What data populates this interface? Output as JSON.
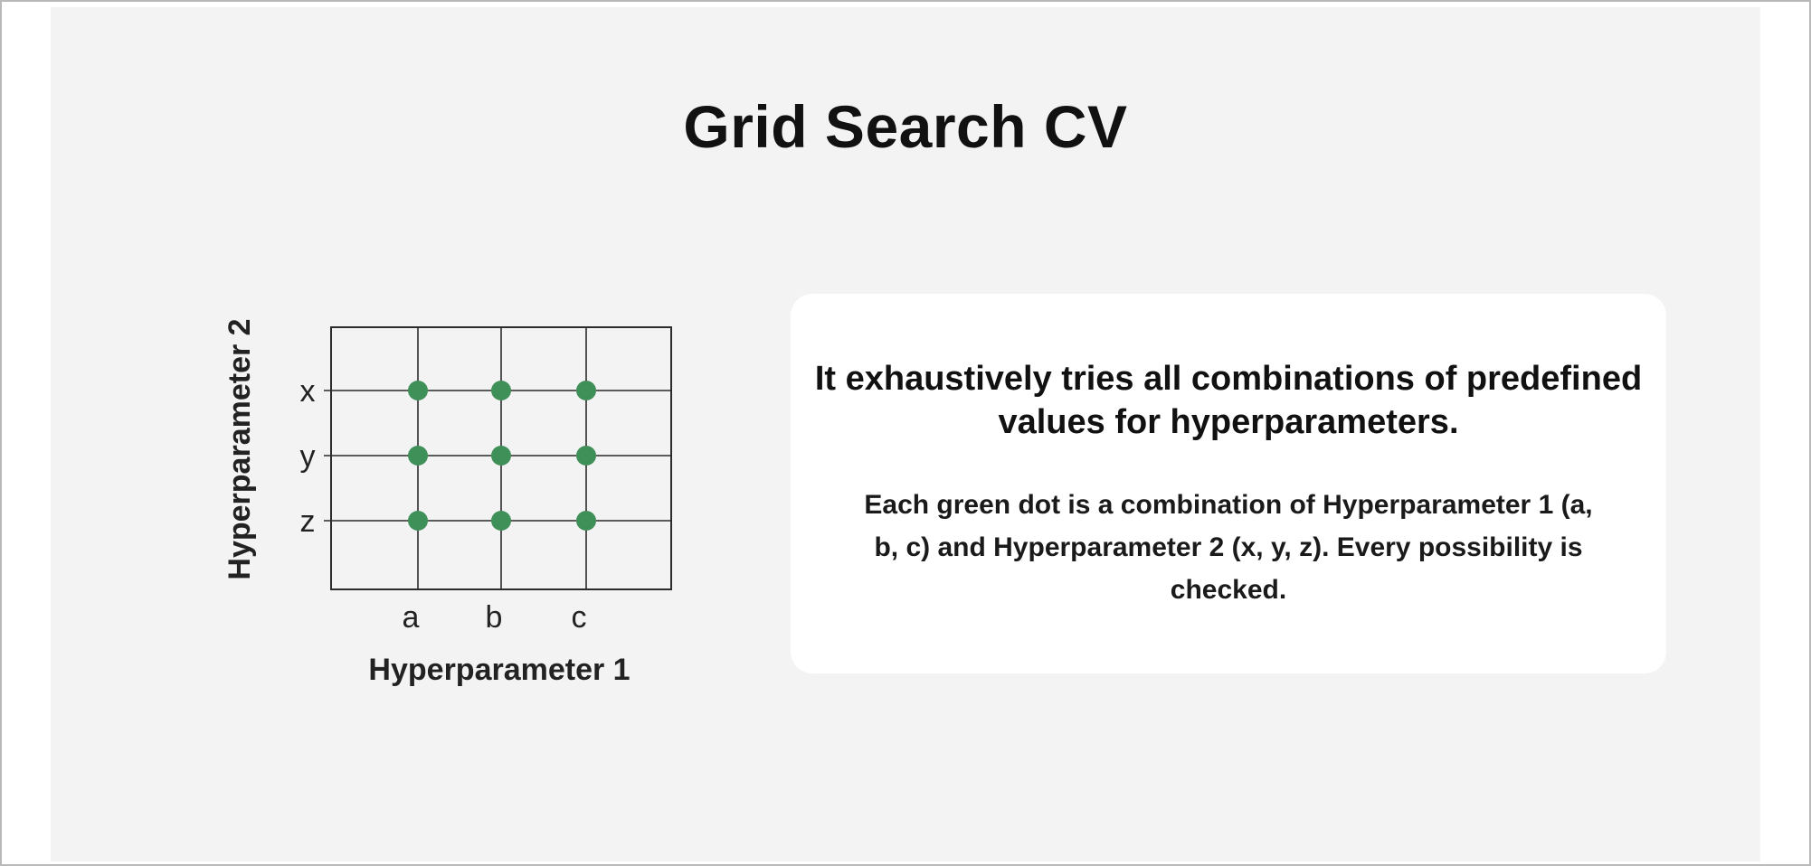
{
  "slide": {
    "title": "Grid Search CV"
  },
  "diagram": {
    "x_axis_label": "Hyperparameter 1",
    "y_axis_label": "Hyperparameter 2",
    "x_values": [
      "a",
      "b",
      "c"
    ],
    "y_values": [
      "x",
      "y",
      "z"
    ],
    "dot_color": "#3f8f59",
    "grid_color": "#2b2b2b"
  },
  "card": {
    "heading": "It exhaustively tries all combinations of predefined values for hyperparameters.",
    "body": "Each green dot is a combination of Hyperparameter 1 (a, b, c) and Hyperparameter 2 (x, y, z). Every possibility is checked."
  }
}
